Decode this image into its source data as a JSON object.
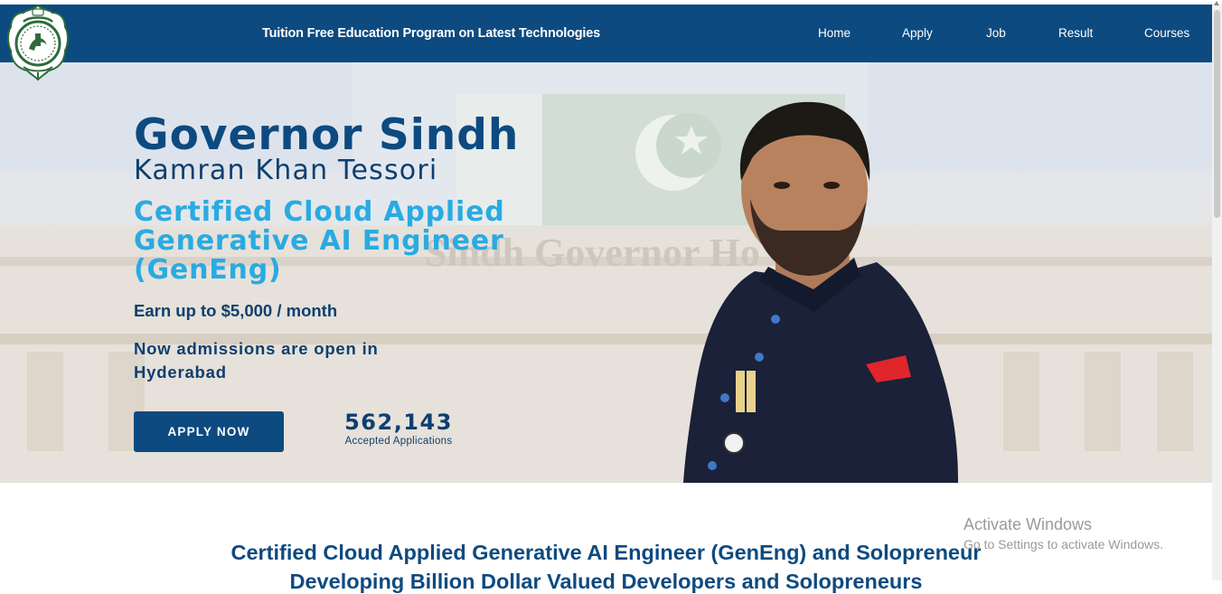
{
  "navbar": {
    "title": "Tuition Free Education Program on Latest Technologies",
    "links": [
      "Home",
      "Apply",
      "Job",
      "Result",
      "Courses"
    ]
  },
  "hero": {
    "heading": "Governor Sindh",
    "name": "Kamran Khan Tessori",
    "certification": "Certified Cloud Applied Generative AI Engineer (GenEng)",
    "earn": "Earn up to $5,000 / month",
    "admissions": "Now admissions are open in Hyderabad",
    "apply_button": "APPLY NOW",
    "applications_count": "562,143",
    "applications_label": "Accepted Applications",
    "background_sign": "Sindh Governor Ho"
  },
  "section": {
    "title": "Certified Cloud Applied Generative AI Engineer (GenEng) and Solopreneur",
    "title_line2": "Developing Billion Dollar Valued Developers and Solopreneurs"
  },
  "watermark": {
    "line1": "Activate Windows",
    "line2": "Go to Settings to activate Windows."
  },
  "colors": {
    "primary": "#0d4a80",
    "accent": "#29abe2",
    "text_dark": "#0d3f70"
  }
}
